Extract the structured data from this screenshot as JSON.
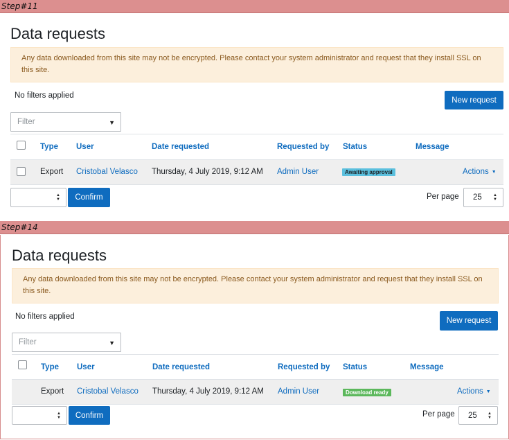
{
  "steps": [
    {
      "label": "Step#11",
      "title": "Data requests",
      "alert": "Any data downloaded from this site may not be encrypted. Please contact your system administrator and request that they install SSL on this site.",
      "filters_label": "No filters applied",
      "new_request_label": "New request",
      "filter_placeholder": "Filter",
      "columns": [
        "Type",
        "User",
        "Date requested",
        "Requested by",
        "Status",
        "Message"
      ],
      "row": {
        "type": "Export",
        "user": "Cristobal Velasco",
        "date": "Thursday, 4 July 2019, 9:12 AM",
        "requested_by": "Admin User",
        "status": "Awaiting approval",
        "message": "",
        "actions": "Actions"
      },
      "bulk_select_value": "",
      "confirm_label": "Confirm",
      "per_page_label": "Per page",
      "per_page_value": "25"
    },
    {
      "label": "Step#14",
      "title": "Data requests",
      "alert": "Any data downloaded from this site may not be encrypted. Please contact your system administrator and request that they install SSL on this site.",
      "filters_label": "No filters applied",
      "new_request_label": "New request",
      "filter_placeholder": "Filter",
      "columns": [
        "Type",
        "User",
        "Date requested",
        "Requested by",
        "Status",
        "Message"
      ],
      "row": {
        "type": "Export",
        "user": "Cristobal Velasco",
        "date": "Thursday, 4 July 2019, 9:12 AM",
        "requested_by": "Admin User",
        "status": "Download ready",
        "message": "",
        "actions": "Actions"
      },
      "bulk_select_value": "",
      "confirm_label": "Confirm",
      "per_page_label": "Per page",
      "per_page_value": "25"
    }
  ],
  "colors": {
    "step_bar": "#dc8f8f",
    "primary": "#0f6cbf",
    "alert_bg": "#fcefdc",
    "badge_awaiting": "#5bc0de",
    "badge_ready": "#5cb85c"
  }
}
